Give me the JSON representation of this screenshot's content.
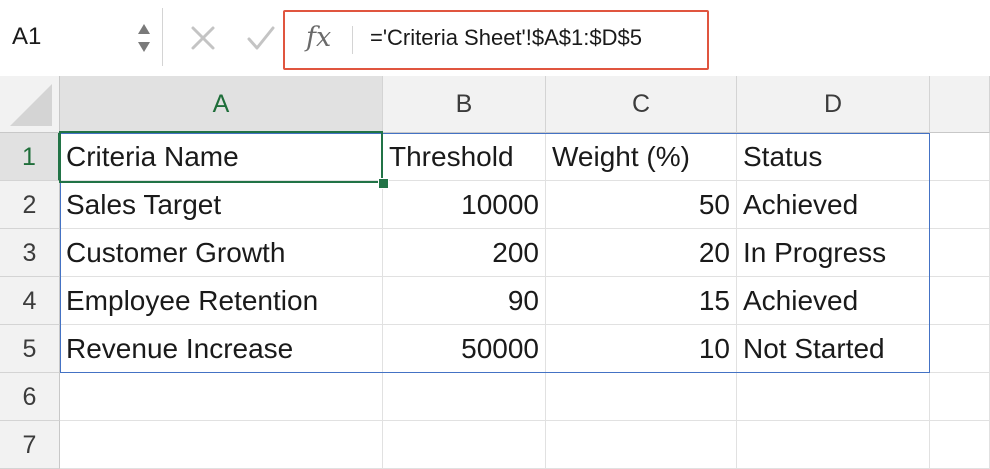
{
  "name_box": {
    "value": "A1"
  },
  "formula_bar": {
    "fx_label": "fx",
    "formula": "='Criteria Sheet'!$A$1:$D$5",
    "highlight_color": "#e0553f"
  },
  "icons": {
    "name_box_stepper": "up-down-arrows-icon",
    "cancel": "x-cancel-icon",
    "enter": "checkmark-enter-icon"
  },
  "columns": [
    "A",
    "B",
    "C",
    "D"
  ],
  "rows": [
    "1",
    "2",
    "3",
    "4",
    "5",
    "6",
    "7"
  ],
  "active_cell": "A1",
  "cells": [
    [
      "Criteria Name",
      "Threshold",
      "Weight (%)",
      "Status"
    ],
    [
      "Sales Target",
      "10000",
      "50",
      "Achieved"
    ],
    [
      "Customer Growth",
      "200",
      "20",
      "In Progress"
    ],
    [
      "Employee Retention",
      "90",
      "15",
      "Achieved"
    ],
    [
      "Revenue Increase",
      "50000",
      "10",
      "Not Started"
    ],
    [
      "",
      "",
      "",
      ""
    ],
    [
      "",
      "",
      "",
      ""
    ]
  ],
  "colors": {
    "selection_green": "#217346",
    "reference_blue": "#4472c4"
  }
}
